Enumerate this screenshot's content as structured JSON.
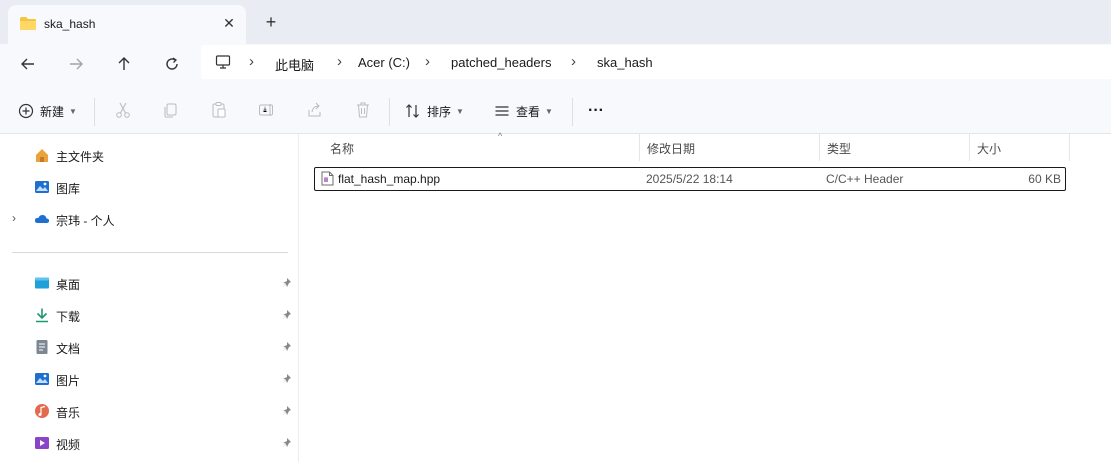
{
  "window": {
    "tab_title": "ska_hash",
    "new_tab_symbol": "+",
    "close_symbol": "✕"
  },
  "address": {
    "breadcrumbs": [
      "此电脑",
      "Acer (C:)",
      "patched_headers",
      "ska_hash"
    ]
  },
  "commands": {
    "new_label": "新建",
    "sort_label": "排序",
    "view_label": "查看",
    "more_label": "···"
  },
  "sidebar": {
    "top_items": [
      {
        "label": "主文件夹",
        "icon": "home-icon"
      },
      {
        "label": "图库",
        "icon": "gallery-icon"
      },
      {
        "label": "宗玮 - 个人",
        "icon": "onedrive-cloud-icon"
      }
    ],
    "quick_access": [
      {
        "label": "桌面",
        "icon": "desktop-icon",
        "pinned": true
      },
      {
        "label": "下载",
        "icon": "download-icon",
        "pinned": true
      },
      {
        "label": "文档",
        "icon": "documents-icon",
        "pinned": true
      },
      {
        "label": "图片",
        "icon": "pictures-icon",
        "pinned": true
      },
      {
        "label": "音乐",
        "icon": "music-icon",
        "pinned": true
      },
      {
        "label": "视频",
        "icon": "videos-icon",
        "pinned": true
      }
    ]
  },
  "file_list": {
    "columns": [
      "名称",
      "修改日期",
      "类型",
      "大小"
    ],
    "sort_indicator": "^",
    "rows": [
      {
        "name": "flat_hash_map.hpp",
        "modified": "2025/5/22 18:14",
        "type": "C/C++ Header",
        "size": "60 KB",
        "icon": "cpp-header-file-icon"
      }
    ]
  },
  "colors": {
    "title_bar_bg": "#e9edf3",
    "toolbar_bg": "#f7f9fc",
    "folder_yellow": "#f4c542",
    "accent_blue": "#1f6fd1"
  }
}
